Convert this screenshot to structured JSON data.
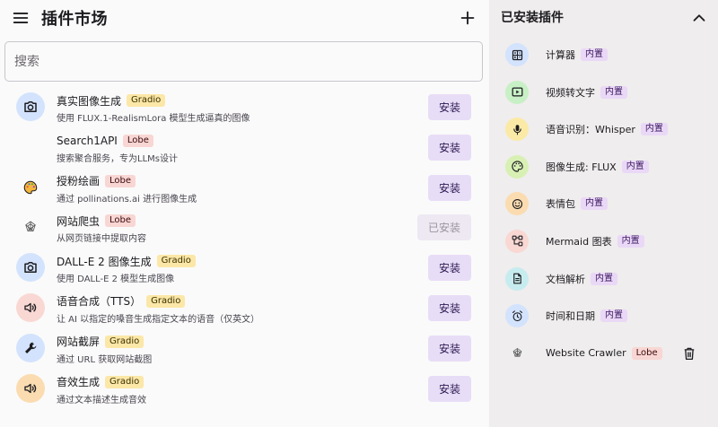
{
  "header": {
    "title": "插件市场",
    "menu_icon": "menu-icon",
    "add_icon": "add-icon"
  },
  "search": {
    "placeholder": "搜索",
    "value": ""
  },
  "market": [
    {
      "name": "真实图像生成",
      "tag": "Gradio",
      "desc": "使用 FLUX.1-RealismLora 模型生成逼真的图像",
      "button": "安装",
      "installed": false,
      "icon": "camera-icon"
    },
    {
      "name": "Search1API",
      "tag": "Lobe",
      "desc": "搜索聚合服务，专为LLMs设计",
      "button": "安装",
      "installed": false,
      "icon": ""
    },
    {
      "name": "授粉绘画",
      "tag": "Lobe",
      "desc": "通过 pollinations.ai 进行图像生成",
      "button": "安装",
      "installed": false,
      "icon": "palette-icon"
    },
    {
      "name": "网站爬虫",
      "tag": "Lobe",
      "desc": "从网页链接中提取内容",
      "button": "已安装",
      "installed": true,
      "icon": "spider-web-icon"
    },
    {
      "name": "DALL-E 2 图像生成",
      "tag": "Gradio",
      "desc": "使用 DALL-E 2 模型生成图像",
      "button": "安装",
      "installed": false,
      "icon": "camera-icon"
    },
    {
      "name": "语音合成（TTS）",
      "tag": "Gradio",
      "desc": "让 AI 以指定的嗓音生成指定文本的语音（仅英文）",
      "button": "安装",
      "installed": false,
      "icon": "speaker-icon"
    },
    {
      "name": "网站截屏",
      "tag": "Gradio",
      "desc": "通过 URL 获取网站截图",
      "button": "安装",
      "installed": false,
      "icon": "wrench-icon"
    },
    {
      "name": "音效生成",
      "tag": "Gradio",
      "desc": "通过文本描述生成音效",
      "button": "安装",
      "installed": false,
      "icon": "speaker-icon"
    }
  ],
  "installed_panel": {
    "title": "已安装插件",
    "collapse_icon": "chevron-up-icon",
    "items": [
      {
        "name": "计算器",
        "tag": "内置",
        "icon": "calculator-icon"
      },
      {
        "name": "视频转文字",
        "tag": "内置",
        "icon": "video-icon"
      },
      {
        "name": "语音识别：Whisper",
        "tag": "内置",
        "icon": "microphone-icon"
      },
      {
        "name": "图像生成: FLUX",
        "tag": "内置",
        "icon": "palette-icon"
      },
      {
        "name": "表情包",
        "tag": "内置",
        "icon": "smiley-icon"
      },
      {
        "name": "Mermaid 图表",
        "tag": "内置",
        "icon": "flowchart-icon"
      },
      {
        "name": "文档解析",
        "tag": "内置",
        "icon": "document-icon"
      },
      {
        "name": "时间和日期",
        "tag": "内置",
        "icon": "alarm-clock-icon"
      },
      {
        "name": "Website Crawler",
        "tag": "Lobe",
        "icon": "spider-web-icon",
        "deletable": true
      }
    ]
  },
  "colors": {
    "blue_icon_bg": "#d3e3fd",
    "red_icon_bg": "#f9d8d3",
    "orange_icon_bg": "#fbdcb1",
    "green_icon_bg": "#c8f0c6",
    "yellow_icon_bg": "#fbeaa6",
    "lime_icon_bg": "#d8f0b4",
    "cyan_icon_bg": "#c7ecef",
    "install_button": "#e8ddf7"
  }
}
